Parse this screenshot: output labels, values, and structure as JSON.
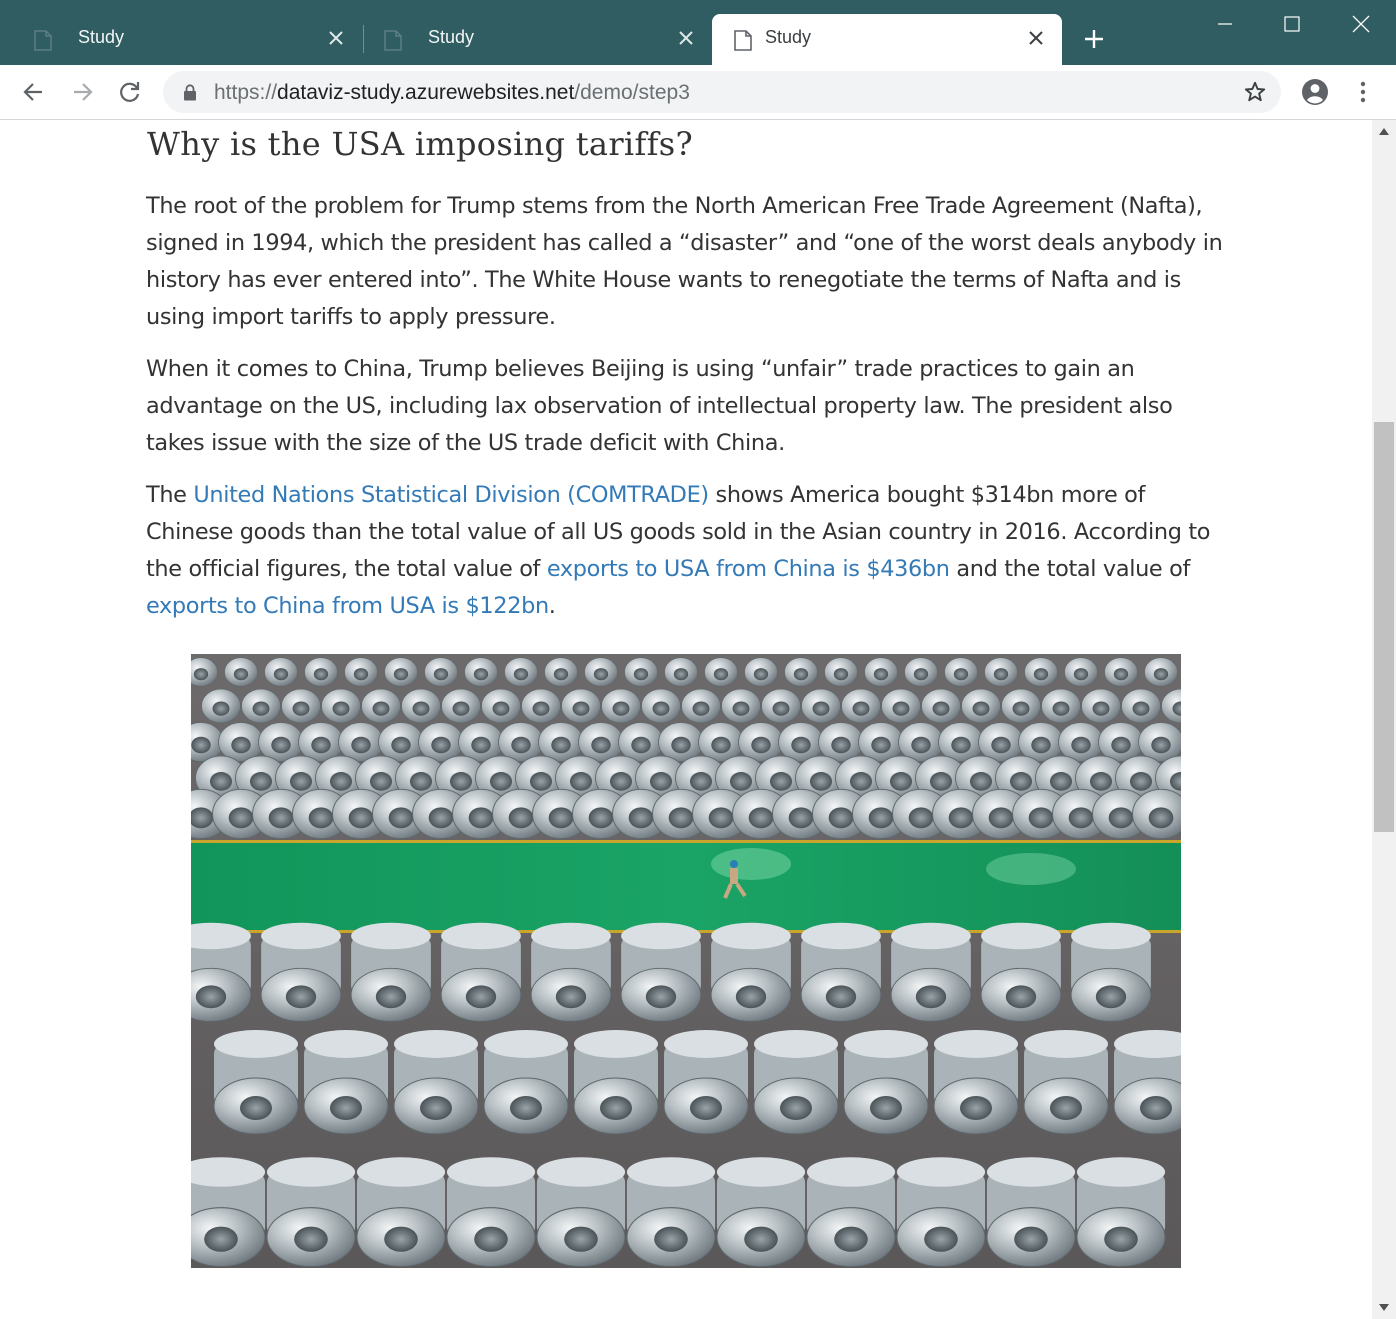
{
  "browser": {
    "tabs": [
      {
        "title": "Study",
        "active": false
      },
      {
        "title": "Study",
        "active": false
      },
      {
        "title": "Study",
        "active": true
      }
    ],
    "url": {
      "scheme": "https://",
      "host": "dataviz-study.azurewebsites.net",
      "path": "/demo/step3"
    }
  },
  "article": {
    "heading": "Why is the USA imposing tariffs?",
    "p1": "The root of the problem for Trump stems from the North American Free Trade Agreement (Nafta), signed in 1994, which the president has called a “disaster” and “one of the worst deals anybody in history has ever entered into”. The White House wants to renegotiate the terms of Nafta and is using import tariffs to apply pressure.",
    "p2": "When it comes to China, Trump believes Beijing is using “unfair” trade practices to gain an advantage on the US, including lax observation of intellectual property law. The president also takes issue with the size of the US trade deficit with China.",
    "p3": {
      "t1": "The ",
      "link1": "United Nations Statistical Division (COMTRADE)",
      "t2": " shows America bought $314bn more of Chinese goods than the total value of all US goods sold in the Asian country in 2016. According to the official figures, the total value of ",
      "link2": "exports to USA from China is $436bn",
      "t3": " and the total value of ",
      "link3": "exports to China from USA is $122bn",
      "t4": "."
    },
    "image_subject": "steel coils warehouse photo"
  },
  "colors": {
    "tabstrip": "#2f5d62",
    "link": "#337ab7",
    "text": "#333333"
  }
}
